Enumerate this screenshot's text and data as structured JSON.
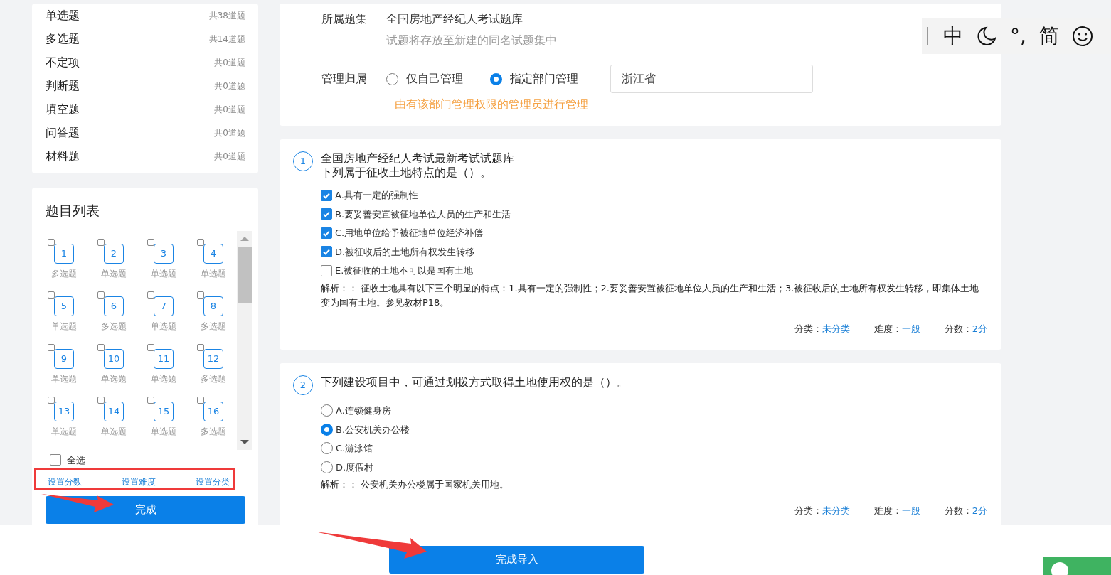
{
  "sidebar": {
    "type_counts": [
      {
        "label": "单选题",
        "count": "共38道题"
      },
      {
        "label": "多选题",
        "count": "共14道题"
      },
      {
        "label": "不定项",
        "count": "共0道题"
      },
      {
        "label": "判断题",
        "count": "共0道题"
      },
      {
        "label": "填空题",
        "count": "共0道题"
      },
      {
        "label": "问答题",
        "count": "共0道题"
      },
      {
        "label": "材料题",
        "count": "共0道题"
      }
    ],
    "question_list": {
      "title": "题目列表",
      "items": [
        {
          "number": "1",
          "type": "多选题",
          "checked": false
        },
        {
          "number": "2",
          "type": "单选题",
          "checked": false
        },
        {
          "number": "3",
          "type": "单选题",
          "checked": false
        },
        {
          "number": "4",
          "type": "单选题",
          "checked": false
        },
        {
          "number": "5",
          "type": "单选题",
          "checked": false
        },
        {
          "number": "6",
          "type": "多选题",
          "checked": false
        },
        {
          "number": "7",
          "type": "单选题",
          "checked": false
        },
        {
          "number": "8",
          "type": "多选题",
          "checked": false
        },
        {
          "number": "9",
          "type": "单选题",
          "checked": false
        },
        {
          "number": "10",
          "type": "单选题",
          "checked": false
        },
        {
          "number": "11",
          "type": "单选题",
          "checked": false
        },
        {
          "number": "12",
          "type": "多选题",
          "checked": false
        },
        {
          "number": "13",
          "type": "单选题",
          "checked": false
        },
        {
          "number": "14",
          "type": "单选题",
          "checked": false
        },
        {
          "number": "15",
          "type": "单选题",
          "checked": false
        },
        {
          "number": "16",
          "type": "多选题",
          "checked": false
        }
      ],
      "select_all": {
        "label": "全选",
        "checked": false
      },
      "actions": [
        "设置分数",
        "设置难度",
        "设置分类"
      ],
      "done_button": "完成"
    }
  },
  "settings": {
    "set_label": "所属题集",
    "set_name": "全国房地产经纪人考试题库",
    "set_hint": "试题将存放至新建的同名试题集中",
    "owner_label": "管理归属",
    "owner_options": [
      {
        "label": "仅自己管理",
        "selected": false
      },
      {
        "label": "指定部门管理",
        "selected": true
      }
    ],
    "department": "浙江省",
    "owner_note": "由有该部门管理权限的管理员进行管理"
  },
  "questions": [
    {
      "number": "1",
      "kind": "multiple",
      "title": "全国房地产经纪人考试最新考试试题库",
      "stem": "下列属于征收土地特点的是（）。",
      "options": [
        {
          "label": "A.具有一定的强制性",
          "selected": true
        },
        {
          "label": "B.要妥善安置被征地单位人员的生产和生活",
          "selected": true
        },
        {
          "label": "C.用地单位给予被征地单位经济补偿",
          "selected": true
        },
        {
          "label": "D.被征收后的土地所有权发生转移",
          "selected": true
        },
        {
          "label": "E.被征收的土地不可以是国有土地",
          "selected": false
        }
      ],
      "analysis": "解析：： 征收土地具有以下三个明显的特点：1.具有一定的强制性；2.要妥善安置被征地单位人员的生产和生活；3.被征收后的土地所有权发生转移，即集体土地变为国有土地。参见教材P18。",
      "meta": [
        {
          "label": "分类：",
          "value": "未分类"
        },
        {
          "label": "难度：",
          "value": "一般"
        },
        {
          "label": "分数：",
          "value": "2分"
        }
      ]
    },
    {
      "number": "2",
      "kind": "single",
      "stem": "下列建设项目中，可通过划拨方式取得土地使用权的是（）。",
      "options": [
        {
          "label": "A.连锁健身房",
          "selected": false
        },
        {
          "label": "B.公安机关办公楼",
          "selected": true
        },
        {
          "label": "C.游泳馆",
          "selected": false
        },
        {
          "label": "D.度假村",
          "selected": false
        }
      ],
      "analysis": "解析：： 公安机关办公楼属于国家机关用地。",
      "meta": [
        {
          "label": "分类：",
          "value": "未分类"
        },
        {
          "label": "难度：",
          "value": "一般"
        },
        {
          "label": "分数：",
          "value": "2分"
        }
      ]
    }
  ],
  "footer": {
    "submit_button": "完成导入"
  },
  "ime_toolbar": {
    "items": [
      "中",
      "°,",
      "简"
    ]
  }
}
